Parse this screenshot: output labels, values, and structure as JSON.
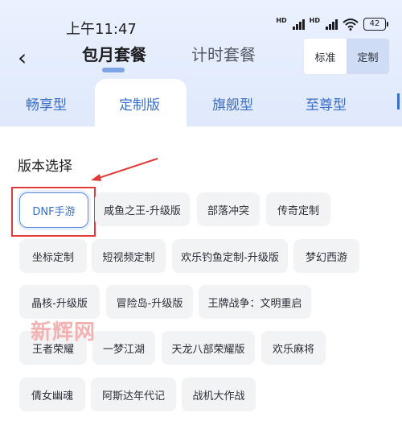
{
  "status_bar": {
    "time": "上午11:47",
    "network_label_1": "HD",
    "network_label_2": "HD",
    "battery": "42"
  },
  "nav": {
    "tabs": [
      "包月套餐",
      "计时套餐"
    ],
    "active_tab": "包月套餐",
    "mode_options": [
      "标准",
      "定制"
    ],
    "mode_selected": "定制"
  },
  "sub_tabs": {
    "items": [
      "畅享型",
      "定制版",
      "旗舰型",
      "至尊型"
    ],
    "active": "定制版"
  },
  "section": {
    "title": "版本选择"
  },
  "chips": [
    {
      "label": "DNF手游",
      "selected": true
    },
    {
      "label": "咸鱼之王-升级版"
    },
    {
      "label": "部落冲突"
    },
    {
      "label": "传奇定制"
    },
    {
      "label": "坐标定制"
    },
    {
      "label": "短视频定制"
    },
    {
      "label": "欢乐钓鱼定制-升级版"
    },
    {
      "label": "梦幻西游"
    },
    {
      "label": "晶核-升级版"
    },
    {
      "label": "冒险岛-升级版"
    },
    {
      "label": "王牌战争：文明重启"
    },
    {
      "label": "王者荣耀"
    },
    {
      "label": "一梦江湖"
    },
    {
      "label": "天龙八部荣耀版"
    },
    {
      "label": "欢乐麻将"
    },
    {
      "label": "倩女幽魂"
    },
    {
      "label": "阿斯达年代记"
    },
    {
      "label": "战机大作战"
    }
  ],
  "watermark": "新辉网",
  "colors": {
    "accent": "#3b6ec6",
    "highlight": "#e23a3a",
    "header_bg": "#dfe9fb"
  }
}
